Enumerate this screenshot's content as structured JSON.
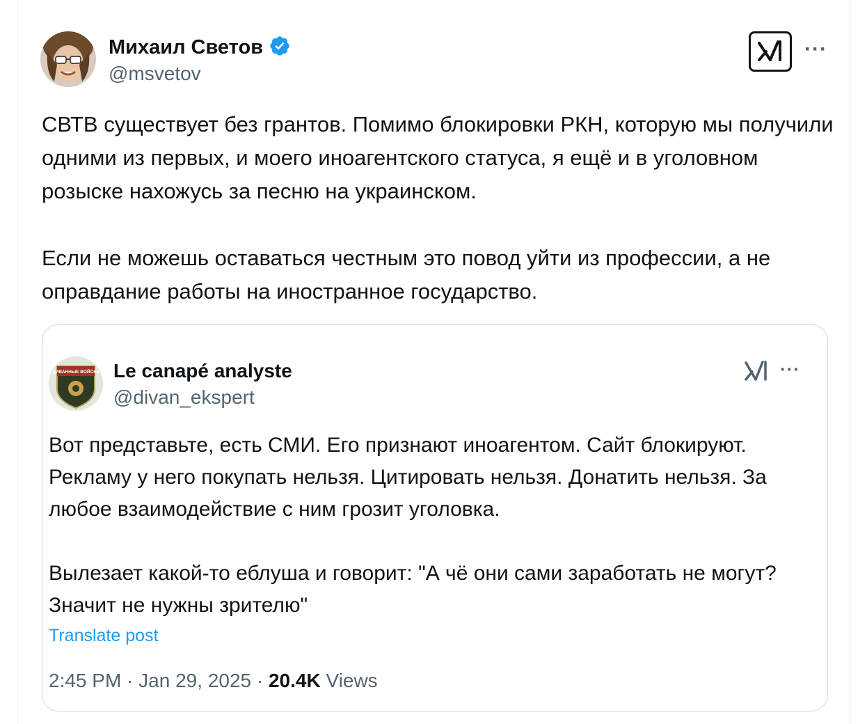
{
  "tweet": {
    "author_name": "Михаил Светов",
    "author_handle": "@msvetov",
    "verified": true,
    "paragraphs": [
      "СВТВ существует без грантов. Помимо блокировки РКН, которую мы получили одними из первых, и моего иноагентского статуса, я ещё и в уголовном розыске нахожусь за песню на украинском.",
      "Если не можешь оставаться честным это повод уйти из профессии, а не оправдание работы на иностранное государство."
    ],
    "more_icon": "more-horizontal-icon",
    "grok_icon": "grok-icon"
  },
  "quoted": {
    "author_name": "Le canapé analyste",
    "author_handle": "@divan_ekspert",
    "avatar_text": "ДИВАННЫЕ ВОЙСКА",
    "paragraphs": [
      "Вот представьте, есть СМИ. Его признают иноагентом. Сайт блокируют. Рекламу у него покупать нельзя. Цитировать нельзя. Донатить нельзя. За любое взаимодействие с ним грозит уголовка.",
      "Вылезает какой-то еблуша и говорит: \"А чё они сами заработать не могут? Значит не нужны зрителю\""
    ],
    "translate_label": "Translate post",
    "time": "2:45 PM",
    "separator": " · ",
    "date": "Jan 29, 2025",
    "views_count": "20.4K",
    "views_label": " Views"
  },
  "colors": {
    "text": "#0f1419",
    "secondary": "#536471",
    "link": "#1d9bf0",
    "border": "#cfd9de",
    "verified": "#1d9bf0"
  }
}
